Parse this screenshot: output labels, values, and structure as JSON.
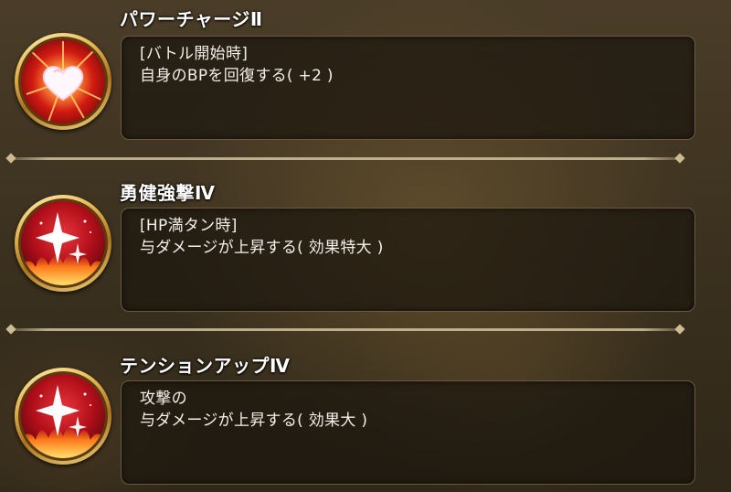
{
  "skills": [
    {
      "title": "パワーチャージⅡ",
      "icon": "heart-burst-icon",
      "lines": [
        "[バトル開始時]",
        "自身のBPを回復する( +2 )"
      ]
    },
    {
      "title": "勇健強撃Ⅳ",
      "icon": "sparkle-flame-icon",
      "lines": [
        "[HP満タン時]",
        "与ダメージが上昇する( 効果特大 )"
      ]
    },
    {
      "title": "テンションアップⅣ",
      "icon": "sparkle-flame-icon",
      "lines": [
        "攻撃の",
        "与ダメージが上昇する( 効果大 )"
      ]
    }
  ],
  "colors": {
    "title": "#ffffff",
    "text": "#f2f0ea",
    "box_bg": "#1c160e",
    "box_border": "#a08c64",
    "icon_red": "#c41818",
    "icon_gold": "#e6b752"
  }
}
